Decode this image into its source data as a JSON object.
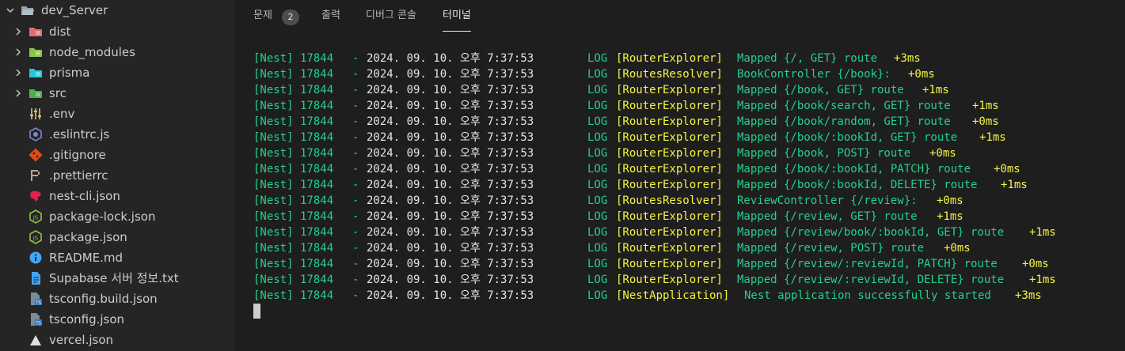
{
  "sidebar": {
    "root": "dev_Server",
    "items": [
      {
        "label": "dist",
        "type": "folder",
        "icon": "dist-folder-icon",
        "color": "#e06c75"
      },
      {
        "label": "node_modules",
        "type": "folder",
        "icon": "node-modules-folder-icon",
        "color": "#8bc34a"
      },
      {
        "label": "prisma",
        "type": "folder",
        "icon": "prisma-folder-icon",
        "color": "#26c6da"
      },
      {
        "label": "src",
        "type": "folder",
        "icon": "src-folder-icon",
        "color": "#4caf50"
      },
      {
        "label": ".env",
        "type": "file",
        "icon": "env-settings-icon",
        "color": "#e5c07b"
      },
      {
        "label": ".eslintrc.js",
        "type": "file",
        "icon": "eslint-icon",
        "color": "#7986cb"
      },
      {
        "label": ".gitignore",
        "type": "file",
        "icon": "git-icon",
        "color": "#e64a19"
      },
      {
        "label": ".prettierrc",
        "type": "file",
        "icon": "prettier-icon",
        "color": "#bfa58a"
      },
      {
        "label": "nest-cli.json",
        "type": "file",
        "icon": "nestjs-icon",
        "color": "#e0234e"
      },
      {
        "label": "package-lock.json",
        "type": "file",
        "icon": "nodejs-icon",
        "color": "#8bc34a"
      },
      {
        "label": "package.json",
        "type": "file",
        "icon": "nodejs-icon",
        "color": "#8bc34a"
      },
      {
        "label": "README.md",
        "type": "file",
        "icon": "info-icon",
        "color": "#42a5f5"
      },
      {
        "label": "Supabase 서버 정보.txt",
        "type": "file",
        "icon": "text-file-icon",
        "color": "#42a5f5"
      },
      {
        "label": "tsconfig.build.json",
        "type": "file",
        "icon": "tsconfig-icon",
        "color": "#3178c6"
      },
      {
        "label": "tsconfig.json",
        "type": "file",
        "icon": "tsconfig-icon",
        "color": "#3178c6"
      },
      {
        "label": "vercel.json",
        "type": "file",
        "icon": "vercel-icon",
        "color": "#e0e0e0"
      }
    ]
  },
  "panel": {
    "tabs": [
      {
        "label": "문제",
        "badge": "2",
        "active": false
      },
      {
        "label": "출력",
        "active": false
      },
      {
        "label": "디버그 콘솔",
        "active": false
      },
      {
        "label": "터미널",
        "active": true
      }
    ]
  },
  "terminal": {
    "lines": [
      {
        "prefix": "[Nest] 17844",
        "dash": "-",
        "time": "2024. 09. 10. 오후 7:37:53",
        "level": "LOG",
        "context": "[RouterExplorer]",
        "message": "Mapped {/, GET} route",
        "duration": "+3ms"
      },
      {
        "prefix": "[Nest] 17844",
        "dash": "-",
        "time": "2024. 09. 10. 오후 7:37:53",
        "level": "LOG",
        "context": "[RoutesResolver]",
        "message": "BookController {/book}:",
        "duration": "+0ms"
      },
      {
        "prefix": "[Nest] 17844",
        "dash": "-",
        "time": "2024. 09. 10. 오후 7:37:53",
        "level": "LOG",
        "context": "[RouterExplorer]",
        "message": "Mapped {/book, GET} route",
        "duration": "+1ms"
      },
      {
        "prefix": "[Nest] 17844",
        "dash": "-",
        "time": "2024. 09. 10. 오후 7:37:53",
        "level": "LOG",
        "context": "[RouterExplorer]",
        "message": "Mapped {/book/search, GET} route",
        "duration": "+1ms"
      },
      {
        "prefix": "[Nest] 17844",
        "dash": "-",
        "time": "2024. 09. 10. 오후 7:37:53",
        "level": "LOG",
        "context": "[RouterExplorer]",
        "message": "Mapped {/book/random, GET} route",
        "duration": "+0ms"
      },
      {
        "prefix": "[Nest] 17844",
        "dash": "-",
        "time": "2024. 09. 10. 오후 7:37:53",
        "level": "LOG",
        "context": "[RouterExplorer]",
        "message": "Mapped {/book/:bookId, GET} route",
        "duration": "+1ms"
      },
      {
        "prefix": "[Nest] 17844",
        "dash": "-",
        "time": "2024. 09. 10. 오후 7:37:53",
        "level": "LOG",
        "context": "[RouterExplorer]",
        "message": "Mapped {/book, POST} route",
        "duration": "+0ms"
      },
      {
        "prefix": "[Nest] 17844",
        "dash": "-",
        "time": "2024. 09. 10. 오후 7:37:53",
        "level": "LOG",
        "context": "[RouterExplorer]",
        "message": "Mapped {/book/:bookId, PATCH} route",
        "duration": "+0ms"
      },
      {
        "prefix": "[Nest] 17844",
        "dash": "-",
        "time": "2024. 09. 10. 오후 7:37:53",
        "level": "LOG",
        "context": "[RouterExplorer]",
        "message": "Mapped {/book/:bookId, DELETE} route",
        "duration": "+1ms"
      },
      {
        "prefix": "[Nest] 17844",
        "dash": "-",
        "time": "2024. 09. 10. 오후 7:37:53",
        "level": "LOG",
        "context": "[RoutesResolver]",
        "message": "ReviewController {/review}:",
        "duration": "+0ms"
      },
      {
        "prefix": "[Nest] 17844",
        "dash": "-",
        "time": "2024. 09. 10. 오후 7:37:53",
        "level": "LOG",
        "context": "[RouterExplorer]",
        "message": "Mapped {/review, GET} route",
        "duration": "+1ms"
      },
      {
        "prefix": "[Nest] 17844",
        "dash": "-",
        "time": "2024. 09. 10. 오후 7:37:53",
        "level": "LOG",
        "context": "[RouterExplorer]",
        "message": "Mapped {/review/book/:bookId, GET} route",
        "duration": "+1ms"
      },
      {
        "prefix": "[Nest] 17844",
        "dash": "-",
        "time": "2024. 09. 10. 오후 7:37:53",
        "level": "LOG",
        "context": "[RouterExplorer]",
        "message": "Mapped {/review, POST} route",
        "duration": "+0ms"
      },
      {
        "prefix": "[Nest] 17844",
        "dash": "-",
        "time": "2024. 09. 10. 오후 7:37:53",
        "level": "LOG",
        "context": "[RouterExplorer]",
        "message": "Mapped {/review/:reviewId, PATCH} route",
        "duration": "+0ms"
      },
      {
        "prefix": "[Nest] 17844",
        "dash": "-",
        "time": "2024. 09. 10. 오후 7:37:53",
        "level": "LOG",
        "context": "[RouterExplorer]",
        "message": "Mapped {/review/:reviewId, DELETE} route",
        "duration": "+1ms"
      },
      {
        "prefix": "[Nest] 17844",
        "dash": "-",
        "time": "2024. 09. 10. 오후 7:37:53",
        "level": "LOG",
        "context": "[NestApplication]",
        "message": "Nest application successfully started",
        "duration": "+3ms"
      }
    ]
  }
}
